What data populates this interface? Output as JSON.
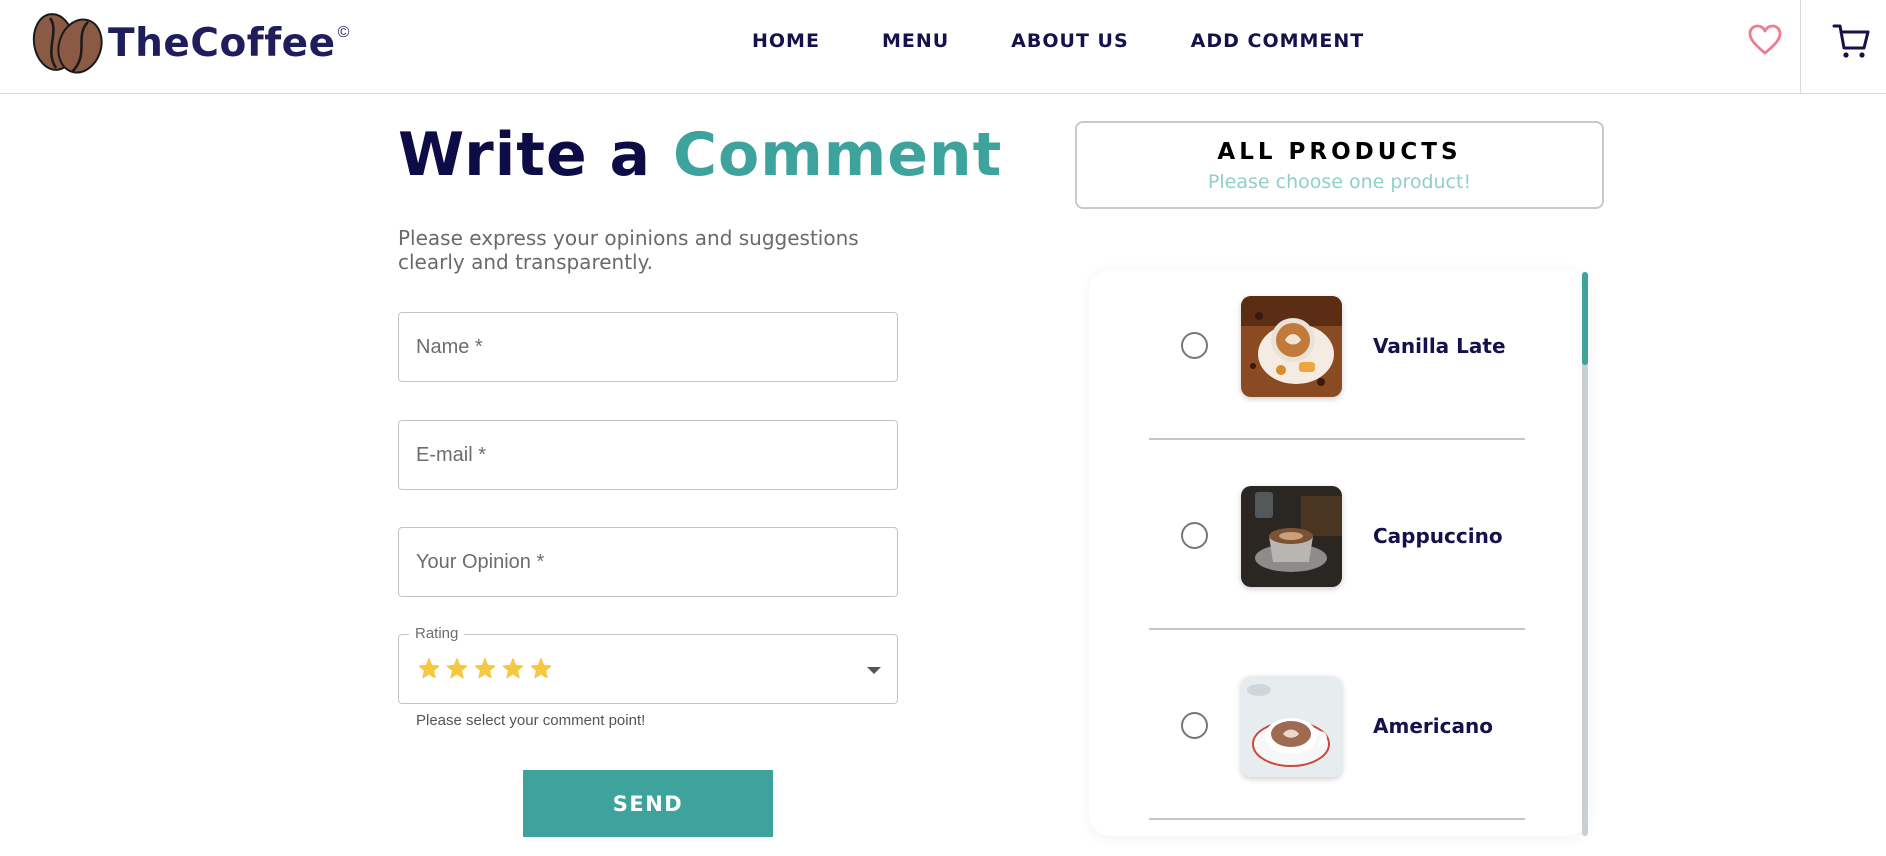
{
  "brand": {
    "name": "TheCoffee",
    "copyright": "©"
  },
  "nav": {
    "items": [
      "HOME",
      "MENU",
      "ABOUT US",
      "ADD COMMENT"
    ]
  },
  "colors": {
    "accent": "#3da39c",
    "heading": "#0e0c47",
    "heart": "#f07a8f",
    "scrollbar": "#c8d0d4",
    "star": "#f5c842"
  },
  "icons": {
    "favorite": "heart-icon",
    "cart": "cart-icon",
    "logo": "coffee-bean-logo",
    "rating": "star-icon",
    "dropdown": "chevron-down-icon"
  },
  "form": {
    "title_part1": "Write a ",
    "title_part2": "Comment",
    "subtitle": "Please express your opinions and suggestions clearly and transparently.",
    "name_placeholder": "Name *",
    "email_placeholder": "E-mail *",
    "opinion_placeholder": "Your Opinion *",
    "rating_label": "Rating",
    "rating_value": 5,
    "rating_max": 5,
    "rating_helper": "Please select your comment point!",
    "send_label": "SEND"
  },
  "products": {
    "title": "ALL PRODUCTS",
    "subtitle": "Please choose one product!",
    "items": [
      {
        "name": "Vanilla Late",
        "selected": false
      },
      {
        "name": "Cappuccino",
        "selected": false
      },
      {
        "name": "Americano",
        "selected": false
      }
    ]
  }
}
